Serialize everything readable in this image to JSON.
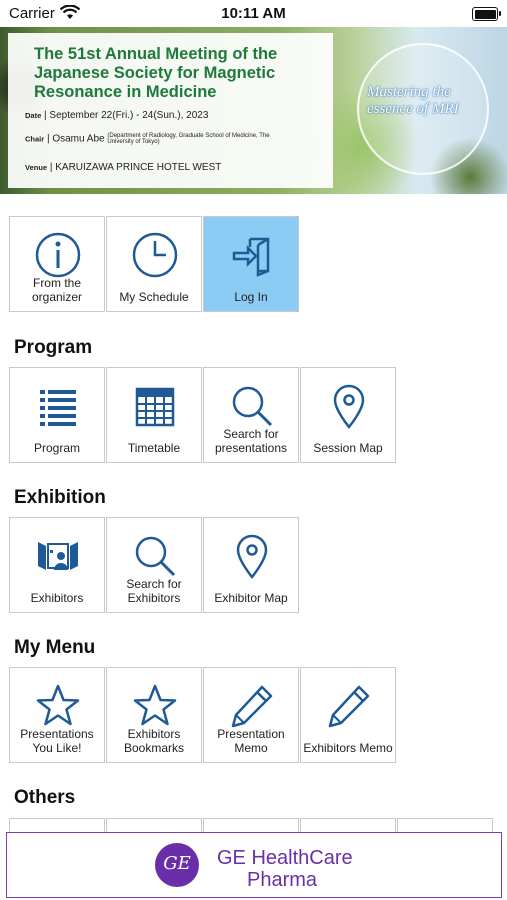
{
  "status_bar": {
    "carrier": "Carrier",
    "time": "10:11 AM"
  },
  "banner": {
    "title": "The 51st Annual Meeting of the Japanese Society for Magnetic Resonance in Medicine",
    "date_label": "Date",
    "date_value": "September 22(Fri.) - 24(Sun.), 2023",
    "chair_label": "Chair",
    "chair_value": "Osamu Abe",
    "chair_affiliation": "(Department of Radiology, Graduate School of Medicine, The University of Tokyo)",
    "venue_label": "Venue",
    "venue_value": "KARUIZAWA PRINCE HOTEL WEST",
    "tagline": "Mastering the essence of MRI"
  },
  "top_menu": [
    {
      "label": "From the organizer",
      "icon": "info-icon"
    },
    {
      "label": "My Schedule",
      "icon": "clock-icon"
    },
    {
      "label": "Log In",
      "icon": "login-icon",
      "active": true
    }
  ],
  "sections": {
    "program": {
      "title": "Program",
      "items": [
        {
          "label": "Program",
          "icon": "list-icon"
        },
        {
          "label": "Timetable",
          "icon": "calendar-icon"
        },
        {
          "label": "Search for presentations",
          "icon": "search-icon"
        },
        {
          "label": "Session Map",
          "icon": "map-pin-icon"
        }
      ]
    },
    "exhibition": {
      "title": "Exhibition",
      "items": [
        {
          "label": "Exhibitors",
          "icon": "exhibitor-booth-icon"
        },
        {
          "label": "Search for Exhibitors",
          "icon": "search-icon"
        },
        {
          "label": "Exhibitor Map",
          "icon": "map-pin-icon"
        }
      ]
    },
    "my_menu": {
      "title": "My Menu",
      "items": [
        {
          "label": "Presentations You Like!",
          "icon": "star-icon"
        },
        {
          "label": "Exhibitors Bookmarks",
          "icon": "star-icon"
        },
        {
          "label": "Presentation Memo",
          "icon": "pencil-icon"
        },
        {
          "label": "Exhibitors Memo",
          "icon": "pencil-icon"
        }
      ]
    },
    "others": {
      "title": "Others"
    }
  },
  "ad": {
    "logo_text": "GE",
    "line1": "GE HealthCare",
    "line2": "Pharma"
  },
  "colors": {
    "icon_blue": "#1f5a96",
    "active_tile": "#8ccbf3",
    "banner_green": "#1d7a3a",
    "ad_purple": "#6a2fa8"
  }
}
